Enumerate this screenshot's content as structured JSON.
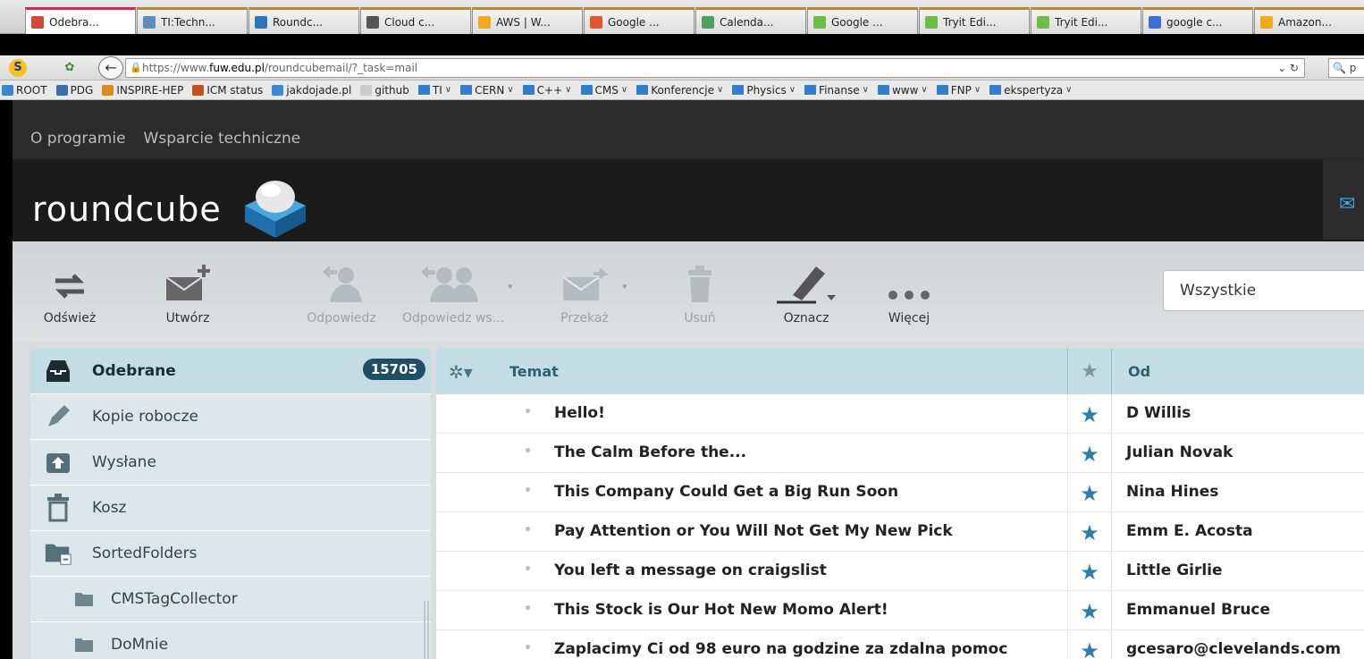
{
  "browser": {
    "tabs": [
      {
        "label": "Odebra...",
        "color": "#d14836"
      },
      {
        "label": "TI:Techn...",
        "color": "#5a8fc0"
      },
      {
        "label": "Roundc...",
        "color": "#2f76b8"
      },
      {
        "label": "Cloud c...",
        "color": "#555555"
      },
      {
        "label": "AWS | W...",
        "color": "#f3a81e"
      },
      {
        "label": "Google ...",
        "color": "#e2572d"
      },
      {
        "label": "Calenda...",
        "color": "#4aa05c"
      },
      {
        "label": "Google ...",
        "color": "#6cbf44"
      },
      {
        "label": "Tryit Edi...",
        "color": "#6cbf44"
      },
      {
        "label": "Tryit Edi...",
        "color": "#6cbf44"
      },
      {
        "label": "google c...",
        "color": "#3b6fd8"
      },
      {
        "label": "Amazon...",
        "color": "#f3a81e"
      }
    ],
    "url_prefix": "https://www.",
    "url_host": "fuw.edu.pl",
    "url_path": "/roundcubemail/?_task=mail",
    "search_placeholder": "p",
    "bookmarks": [
      {
        "label": "ROOT",
        "folder": false,
        "color": "#3a86d4"
      },
      {
        "label": "PDG",
        "folder": false,
        "color": "#3d6ea5"
      },
      {
        "label": "INSPIRE-HEP",
        "folder": false,
        "color": "#e08a1e"
      },
      {
        "label": "ICM status",
        "folder": false,
        "color": "#c0541a"
      },
      {
        "label": "jakdojade.pl",
        "folder": false,
        "color": "#3b8ad9"
      },
      {
        "label": "github",
        "folder": false,
        "color": "#cccccc"
      },
      {
        "label": "TI",
        "folder": true
      },
      {
        "label": "CERN",
        "folder": true
      },
      {
        "label": "C++",
        "folder": true
      },
      {
        "label": "CMS",
        "folder": true
      },
      {
        "label": "Konferencje",
        "folder": true
      },
      {
        "label": "Physics",
        "folder": true
      },
      {
        "label": "Finanse",
        "folder": true
      },
      {
        "label": "www",
        "folder": true
      },
      {
        "label": "FNP",
        "folder": true
      },
      {
        "label": "ekspertyza",
        "folder": true
      }
    ]
  },
  "topnav": [
    "O programie",
    "Wsparcie techniczne"
  ],
  "logo_text": "roundcube",
  "toolbar": {
    "refresh": "Odśwież",
    "compose": "Utwórz",
    "reply": "Odpowiedz",
    "reply_all": "Odpowiedz ws...",
    "forward": "Przekaż",
    "delete": "Usuń",
    "mark": "Oznacz",
    "more": "Więcej",
    "filter_value": "Wszystkie"
  },
  "folders": [
    {
      "label": "Odebrane",
      "badge": "15705",
      "icon": "inbox-icon",
      "selected": true,
      "sub": false
    },
    {
      "label": "Kopie robocze",
      "icon": "drafts-icon",
      "selected": false,
      "sub": false
    },
    {
      "label": "Wysłane",
      "icon": "sent-icon",
      "selected": false,
      "sub": false
    },
    {
      "label": "Kosz",
      "icon": "trash-icon",
      "selected": false,
      "sub": false
    },
    {
      "label": "SortedFolders",
      "icon": "folder-collapse-icon",
      "selected": false,
      "sub": false
    },
    {
      "label": "CMSTagCollector",
      "icon": "folder-icon",
      "selected": false,
      "sub": true
    },
    {
      "label": "DoMnie",
      "icon": "folder-icon",
      "selected": false,
      "sub": true
    }
  ],
  "messages_header": {
    "subject": "Temat",
    "from": "Od"
  },
  "messages": [
    {
      "subject": "Hello!",
      "from": "D Willis"
    },
    {
      "subject": "The Calm Before the...",
      "from": "Julian Novak"
    },
    {
      "subject": "This Company Could Get a Big Run Soon",
      "from": "Nina Hines"
    },
    {
      "subject": "Pay Attention or You Will Not Get My New Pick",
      "from": "Emm E. Acosta"
    },
    {
      "subject": "You left a message on craigslist",
      "from": "Little Girlie"
    },
    {
      "subject": "This Stock is Our Hot New Momo Alert!",
      "from": "Emmanuel Bruce"
    },
    {
      "subject": "Zaplacimy Ci od 98 euro na godzine za zdalna pomoc",
      "from": "gcesaro@clevelands.com"
    }
  ]
}
